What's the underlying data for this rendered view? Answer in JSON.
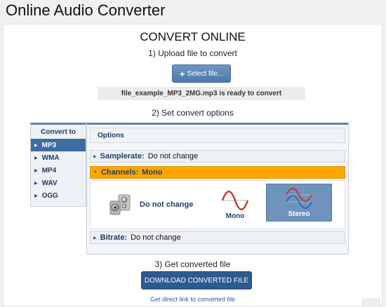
{
  "app_title": "Online Audio Converter",
  "convert_title": "CONVERT ONLINE",
  "step1_label": "1) Upload file to convert",
  "select_file_label": "Select file...",
  "file_status": "file_example_MP3_2MG.mp3 is ready to convert",
  "step2_label": "2) Set convert options",
  "convert_to": {
    "title": "Convert to",
    "formats": [
      {
        "label": "MP3",
        "selected": true
      },
      {
        "label": "WMA",
        "selected": false
      },
      {
        "label": "MP4",
        "selected": false
      },
      {
        "label": "WAV",
        "selected": false
      },
      {
        "label": "OGG",
        "selected": false
      }
    ]
  },
  "options": {
    "header": "Options",
    "samplerate": {
      "label": "Samplerate:",
      "value": "Do not change"
    },
    "channels": {
      "label": "Channels:",
      "value": "Mono",
      "choices": {
        "no_change": "Do not change",
        "mono": "Mono",
        "stereo": "Stereo"
      }
    },
    "bitrate": {
      "label": "Bitrate:",
      "value": "Do not change"
    }
  },
  "step3_label": "3) Get converted file",
  "download_label": "DOWNLOAD CONVERTED FILE",
  "direct_link_label": "Get direct link to converted file",
  "colors": {
    "accent": "#3e6da0",
    "active_option": "#ffa500",
    "download_button": "#2c5a91"
  }
}
